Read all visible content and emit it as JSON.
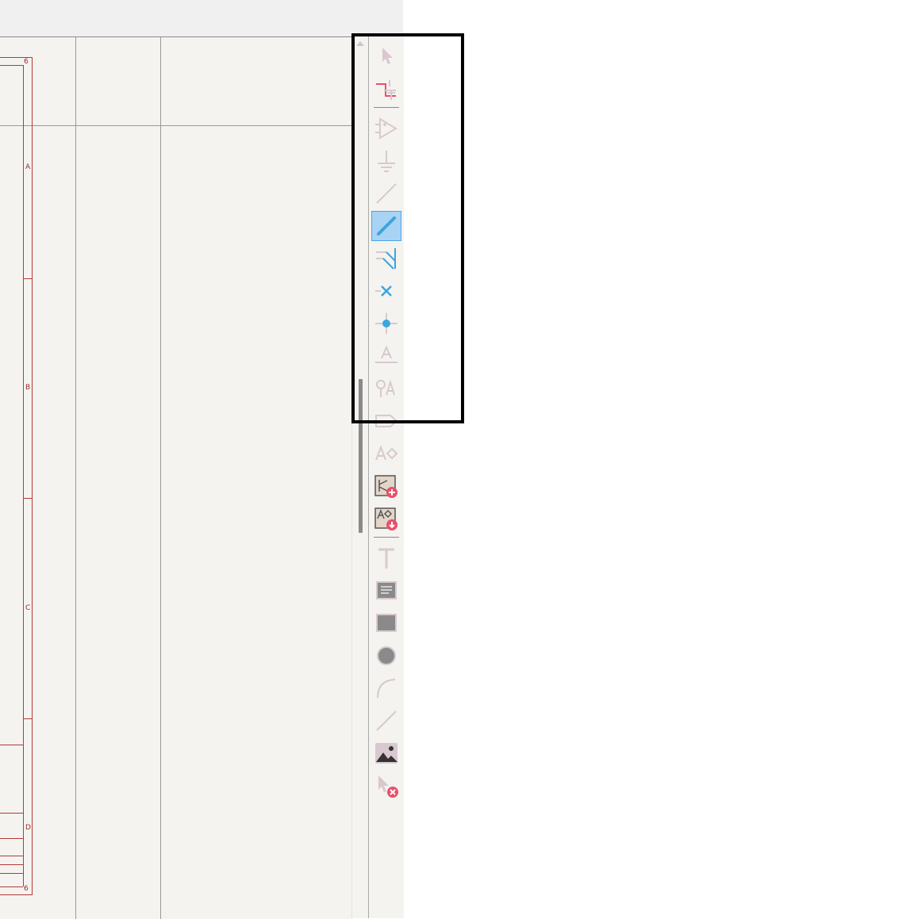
{
  "schematic": {
    "zone_labels": {
      "top_number": "6",
      "bottom_number": "6",
      "row_a": "A",
      "row_b": "B",
      "row_c": "C",
      "row_d": "D"
    }
  },
  "toolbar": {
    "tools": [
      {
        "name": "select-tool-icon",
        "state": "disabled"
      },
      {
        "name": "highlight-net-icon",
        "state": "enabled"
      },
      {
        "name": "add-symbol-icon",
        "state": "disabled"
      },
      {
        "name": "add-power-icon",
        "state": "disabled"
      },
      {
        "name": "add-wire-icon",
        "state": "disabled"
      },
      {
        "name": "add-bus-icon",
        "state": "active"
      },
      {
        "name": "bus-wire-entry-icon",
        "state": "enabled"
      },
      {
        "name": "no-connect-icon",
        "state": "enabled"
      },
      {
        "name": "junction-icon",
        "state": "enabled"
      },
      {
        "name": "net-label-icon",
        "state": "disabled"
      },
      {
        "name": "global-label-icon",
        "state": "disabled"
      },
      {
        "name": "hierarchical-label-icon",
        "state": "disabled"
      },
      {
        "name": "directive-label-icon",
        "state": "disabled"
      },
      {
        "name": "add-sheet-icon",
        "state": "enabled"
      },
      {
        "name": "import-sheet-pin-icon",
        "state": "enabled"
      },
      {
        "name": "add-text-icon",
        "state": "disabled"
      },
      {
        "name": "add-textbox-icon",
        "state": "enabled"
      },
      {
        "name": "add-rectangle-icon",
        "state": "enabled"
      },
      {
        "name": "add-circle-icon",
        "state": "enabled"
      },
      {
        "name": "add-arc-icon",
        "state": "disabled"
      },
      {
        "name": "add-line-icon",
        "state": "disabled"
      },
      {
        "name": "add-image-icon",
        "state": "enabled"
      },
      {
        "name": "delete-tool-icon",
        "state": "enabled"
      }
    ]
  },
  "colors": {
    "canvas": "#f4f3ef",
    "frame": "#b33a3a",
    "accent_blue": "#3aa6dd",
    "accent_red": "#e8506c",
    "disabled_icon": "#d9c8cf"
  }
}
